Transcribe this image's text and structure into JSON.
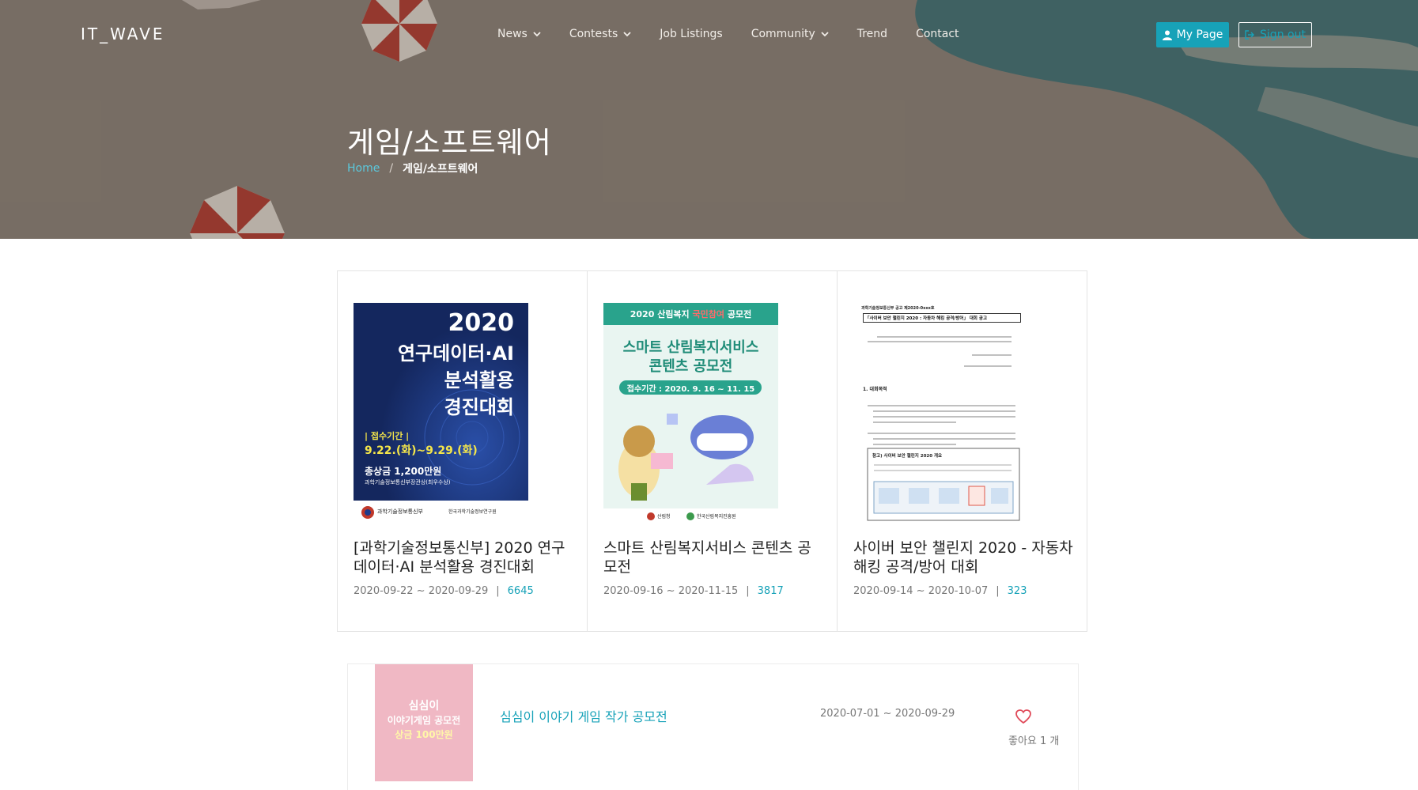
{
  "header": {
    "brand": "IT_WAVE",
    "nav": [
      {
        "label": "News",
        "dropdown": true
      },
      {
        "label": "Contests",
        "dropdown": true
      },
      {
        "label": "Job Listings",
        "dropdown": false
      },
      {
        "label": "Community",
        "dropdown": true
      },
      {
        "label": "Trend",
        "dropdown": false
      },
      {
        "label": "Contact",
        "dropdown": false
      }
    ],
    "mypage_label": "My Page",
    "signout_label": "Sign out"
  },
  "hero": {
    "title": "게임/소프트웨어",
    "breadcrumb": {
      "home": "Home",
      "separator": "/",
      "current": "게임/소프트웨어"
    }
  },
  "cards": [
    {
      "title": "[과학기술정보통신부] 2020 연구데이터·AI 분석활용 경진대회",
      "period": "2020-09-22 ~ 2020-09-29",
      "separator": "|",
      "views": "6645",
      "poster": {
        "year": "2020",
        "line1": "연구데이터·AI",
        "line2": "분석활용",
        "line3": "경진대회",
        "period_label": "| 접수기간 |",
        "period": "9.22.(화)~9.29.(화)",
        "prize": "총상금 1,200만원",
        "prize_sub": "과학기술정보통신부장관상(최우수상)",
        "org1": "과학기술정보통신부",
        "org2": "한국과학기술정보연구원"
      }
    },
    {
      "title": "스마트 산림복지서비스 콘텐츠 공모전",
      "period": "2020-09-16 ~ 2020-11-15",
      "separator": "|",
      "views": "3817",
      "poster": {
        "top_a": "2020 산림복지",
        "top_b": "국민참여",
        "top_c": "공모전",
        "line1": "스마트 산림복지서비스",
        "line2": "콘텐츠 공모전",
        "period": "접수기간 : 2020. 9. 16 ~ 11. 15",
        "org1": "산림청",
        "org2": "한국산림복지진흥원"
      }
    },
    {
      "title": "사이버 보안 챌린지 2020 - 자동차 해킹 공격/방어 대회",
      "period": "2020-09-14 ~ 2020-10-07",
      "separator": "|",
      "views": "323",
      "poster": {
        "notice_no": "과학기술정보통신부 공고 제2020-0xxx호",
        "headline": "「사이버 보안 챌린지 2020 : 자동차 해킹 공격/방어」 대회 공고",
        "section": "1. 대회목적",
        "box_title": "참고) 사이버 보안 챌린지 2020 개요"
      }
    }
  ],
  "list": [
    {
      "title": "심심이 이야기 게임 작가 공모전",
      "period": "2020-07-01 ~ 2020-09-29",
      "likes": "좋아요 1 개",
      "poster": {
        "line1": "심심이",
        "line2": "이야기게임 공모전",
        "line3": "상금 100만원"
      }
    }
  ],
  "colors": {
    "accent": "#17a2b8",
    "hero_bg": "#8d8378",
    "teal_shape": "#2f6e74",
    "red_shape": "#c0392b"
  }
}
